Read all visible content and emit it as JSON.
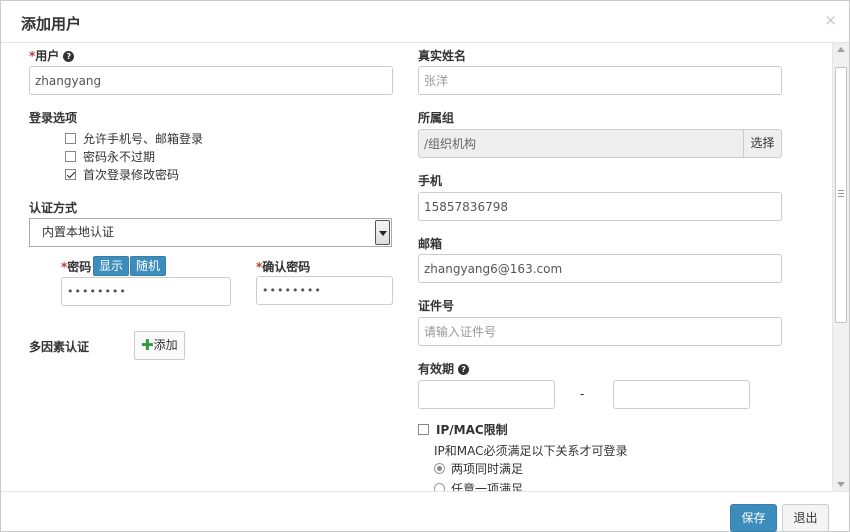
{
  "dialog": {
    "title": "添加用户",
    "close": "×"
  },
  "left": {
    "user": {
      "label": "用户",
      "required_mark": "*",
      "value": "zhangyang"
    },
    "login_options": {
      "label": "登录选项",
      "items": [
        {
          "label": "允许手机号、邮箱登录",
          "checked": false
        },
        {
          "label": "密码永不过期",
          "checked": false
        },
        {
          "label": "首次登录修改密码",
          "checked": true
        }
      ]
    },
    "auth": {
      "label": "认证方式",
      "selected": "内置本地认证"
    },
    "password": {
      "required_mark": "*",
      "label": "密码",
      "show_label": "显示",
      "random_label": "随机",
      "value": "••••••••"
    },
    "confirm_password": {
      "required_mark": "*",
      "label": "确认密码",
      "value": "••••••••"
    },
    "mfa": {
      "label": "多因素认证",
      "add_label": "添加"
    }
  },
  "right": {
    "real_name": {
      "label": "真实姓名",
      "placeholder": "张洋"
    },
    "group": {
      "label": "所属组",
      "value": "/组织机构",
      "select_label": "选择"
    },
    "phone": {
      "label": "手机",
      "value": "15857836798"
    },
    "email": {
      "label": "邮箱",
      "value": "zhangyang6@163.com"
    },
    "id_number": {
      "label": "证件号",
      "placeholder": "请输入证件号"
    },
    "validity": {
      "label": "有效期",
      "separator": "-",
      "start": "",
      "end": ""
    },
    "ipmac": {
      "label": "IP/MAC限制",
      "checked": false,
      "description": "IP和MAC必须满足以下关系才可登录",
      "options": [
        {
          "label": "两项同时满足",
          "checked": true
        },
        {
          "label": "任意一项满足",
          "checked": false
        }
      ]
    }
  },
  "footer": {
    "save_label": "保存",
    "exit_label": "退出"
  },
  "colors": {
    "primary": "#3c8dbc",
    "required": "#c0392b",
    "add_plus": "#2e9a3f"
  }
}
